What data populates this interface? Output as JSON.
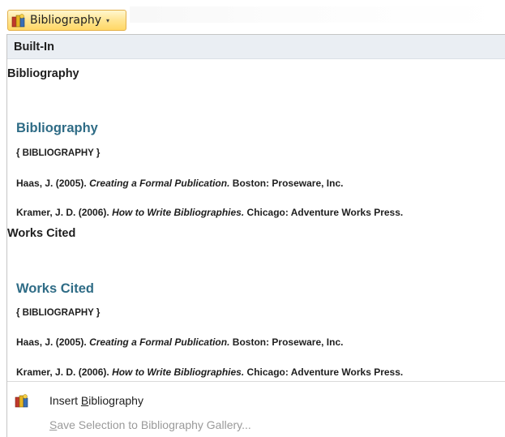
{
  "ribbon": {
    "button_label": "Bibliography",
    "dropdown_glyph": "▾",
    "button_icon": "bibliography-books-icon"
  },
  "gallery": {
    "section_title": "Built-In",
    "items": [
      {
        "title": "Bibliography",
        "preview_heading": "Bibliography",
        "field_code": "{ BIBLIOGRAPHY }",
        "entries": [
          {
            "pre": "Haas, J. (2005). ",
            "italic": "Creating a Formal Publication.",
            "post": " Boston: Proseware, Inc."
          },
          {
            "pre": "Kramer, J. D. (2006). ",
            "italic": "How to Write Bibliographies.",
            "post": " Chicago: Adventure Works Press."
          }
        ]
      },
      {
        "title": "Works Cited",
        "preview_heading": "Works Cited",
        "field_code": "{ BIBLIOGRAPHY }",
        "entries": [
          {
            "pre": "Haas, J. (2005). ",
            "italic": "Creating a Formal Publication.",
            "post": " Boston: Proseware, Inc."
          },
          {
            "pre": "Kramer, J. D. (2006). ",
            "italic": "How to Write Bibliographies.",
            "post": " Chicago: Adventure Works Press."
          }
        ]
      }
    ]
  },
  "menu": {
    "insert": {
      "before": "Insert ",
      "accel": "B",
      "after": "ibliography",
      "icon": "bibliography-books-icon"
    },
    "save": {
      "before": "",
      "accel": "S",
      "after": "ave Selection to Bibliography Gallery...",
      "disabled": true
    }
  },
  "colors": {
    "heading": "#2f6c86",
    "button_highlight": "#ffe592",
    "section_bg": "#eaeef3"
  }
}
